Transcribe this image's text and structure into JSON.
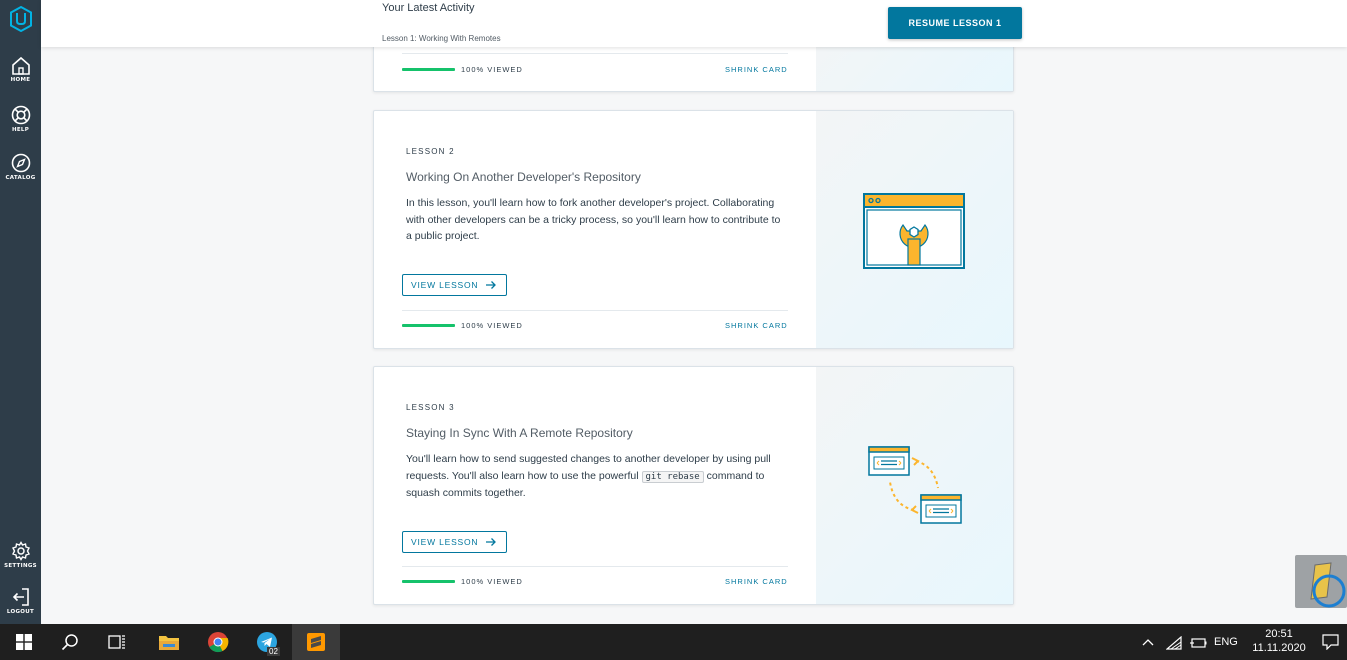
{
  "sidebar": {
    "logo_icon": "udacity-logo",
    "items_top": [
      {
        "label": "HOME",
        "icon": "home-icon"
      },
      {
        "label": "HELP",
        "icon": "lifebuoy-icon"
      },
      {
        "label": "CATALOG",
        "icon": "compass-icon"
      }
    ],
    "items_bottom": [
      {
        "label": "SETTINGS",
        "icon": "gear-icon"
      },
      {
        "label": "LOGOUT",
        "icon": "logout-icon"
      }
    ]
  },
  "header": {
    "title": "Your Latest Activity",
    "subtitle": "Lesson 1: Working With Remotes",
    "resume_button": "RESUME LESSON 1"
  },
  "cards": [
    {
      "viewed_label": "100% VIEWED",
      "progress": 1.0,
      "shrink_label": "SHRINK CARD"
    },
    {
      "number": "LESSON 2",
      "title": "Working On Another Developer's Repository",
      "description": "In this lesson, you'll learn how to fork another developer's project. Collaborating with other developers can be a tricky process, so you'll learn how to contribute to a public project.",
      "view_button": "VIEW LESSON",
      "viewed_label": "100% VIEWED",
      "progress": 1.0,
      "shrink_label": "SHRINK CARD",
      "illustration": "browser-wrench-icon"
    },
    {
      "number": "LESSON 3",
      "title": "Staying In Sync With A Remote Repository",
      "description_part1": "You'll learn how to send suggested changes to another developer by using pull requests. You'll also learn how to use the powerful ",
      "description_code": "git rebase",
      "description_part2": " command to squash commits together.",
      "view_button": "VIEW LESSON",
      "viewed_label": "100% VIEWED",
      "progress": 1.0,
      "shrink_label": "SHRINK CARD",
      "illustration": "sync-windows-icon"
    }
  ],
  "taskbar": {
    "apps": [
      "windows-start-icon",
      "search-icon",
      "task-view-icon",
      "file-explorer-icon",
      "chrome-icon",
      "telegram-icon",
      "sublime-text-icon"
    ],
    "telegram_badge": "02",
    "language": "ENG",
    "time": "20:51",
    "date": "11.11.2020"
  },
  "colors": {
    "sidebar": "#2e3d49",
    "accent": "#02779e",
    "progress": "#15c26b",
    "illustration_orange": "#fcb52d",
    "illustration_blue": "#02779e"
  }
}
